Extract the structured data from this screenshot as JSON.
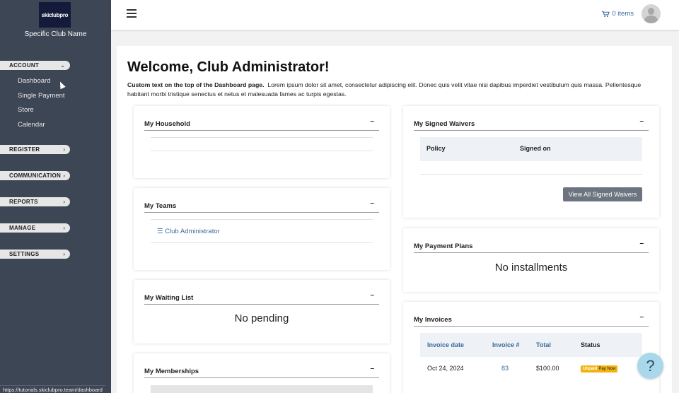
{
  "sidebar": {
    "logo_text": "skiclubpro",
    "club_name": "Specific Club Name",
    "sections": {
      "account": "ACCOUNT",
      "register": "REGISTER",
      "communication": "COMMUNICATION",
      "reports": "REPORTS",
      "manage": "MANAGE",
      "settings": "SETTINGS"
    },
    "account_items": {
      "dashboard": "Dashboard",
      "single_payment": "Single Payment",
      "store": "Store",
      "calendar": "Calendar"
    }
  },
  "topbar": {
    "cart_label": "0 items"
  },
  "main": {
    "welcome": "Welcome, Club Administrator!",
    "desc_bold": "Custom text on the top of the Dashboard page.",
    "desc_text": "Lorem ipsum dolor sit amet, consectetur adipiscing elit. Donec quis velit vitae nisi dapibus imperdiet vestibulum quis massa. Pellentesque habitant morbi tristique senectus et netus et malesuada fames ac turpis egestas."
  },
  "cards": {
    "household": {
      "title": "My Household",
      "min": "–"
    },
    "teams": {
      "title": "My Teams",
      "min": "–",
      "team_link": "Club Administrator"
    },
    "waiting": {
      "title": "My Waiting List",
      "min": "–",
      "empty": "No pending"
    },
    "memberships": {
      "title": "My Memberships",
      "min": "–"
    },
    "waivers": {
      "title": "My Signed Waivers",
      "min": "–",
      "col_policy": "Policy",
      "col_signed": "Signed on",
      "button": "View All Signed Waivers"
    },
    "payment_plans": {
      "title": "My Payment Plans",
      "min": "–",
      "empty": "No installments"
    },
    "invoices": {
      "title": "My Invoices",
      "min": "–",
      "col_date": "Invoice date",
      "col_num": "Invoice #",
      "col_total": "Total",
      "col_status": "Status",
      "row": {
        "date": "Oct 24, 2024",
        "number": "83",
        "total": "$100.00",
        "status": "Unpaid",
        "pay": "Pay Now"
      }
    }
  },
  "help_label": "?",
  "status_url": "https://tutorials.skiclubpro.team/dashboard",
  "colors": {
    "sidebar": "#3c4654",
    "link": "#3a6a9a",
    "badge": "#f2b311"
  }
}
